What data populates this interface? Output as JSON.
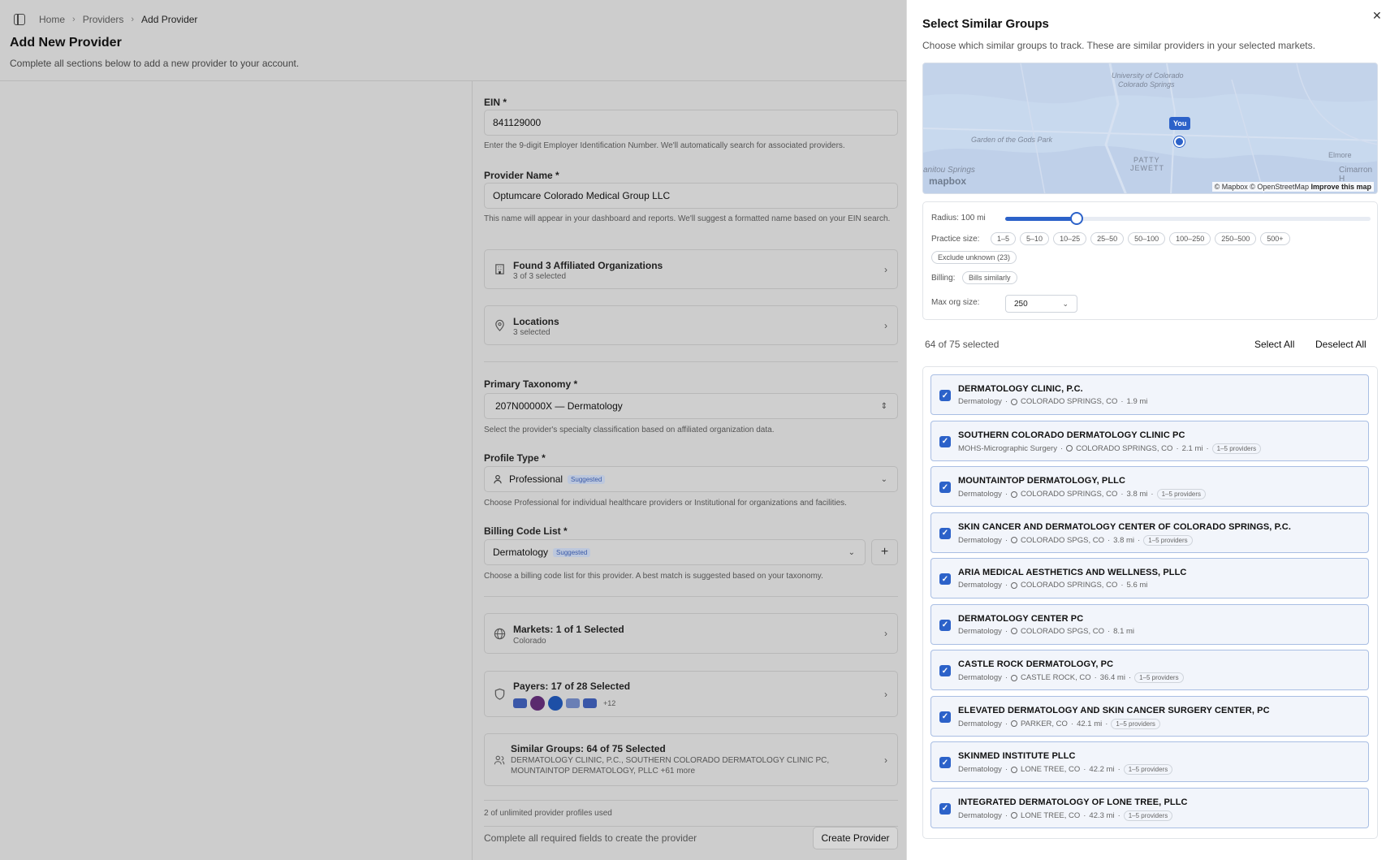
{
  "breadcrumb": {
    "items": [
      "Home",
      "Providers",
      "Add Provider"
    ]
  },
  "page": {
    "title": "Add New Provider",
    "subtitle": "Complete all sections below to add a new provider to your account."
  },
  "form": {
    "ein": {
      "label": "EIN *",
      "value": "841129000",
      "help": "Enter the 9-digit Employer Identification Number. We'll automatically search for associated providers."
    },
    "provider_name": {
      "label": "Provider Name *",
      "value": "Optumcare Colorado Medical Group LLC",
      "help": "This name will appear in your dashboard and reports. We'll suggest a formatted name based on your EIN search."
    },
    "affiliated": {
      "title": "Found 3 Affiliated Organizations",
      "sub": "3 of 3 selected"
    },
    "locations": {
      "title": "Locations",
      "sub": "3 selected"
    },
    "taxonomy": {
      "label": "Primary Taxonomy *",
      "value": "207N00000X — Dermatology",
      "help": "Select the provider's specialty classification based on affiliated organization data."
    },
    "profile_type": {
      "label": "Profile Type *",
      "value": "Professional",
      "badge": "Suggested",
      "help": "Choose Professional for individual healthcare providers or Institutional for organizations and facilities."
    },
    "billing": {
      "label": "Billing Code List *",
      "value": "Dermatology",
      "badge": "Suggested",
      "help": "Choose a billing code list for this provider. A best match is suggested based on your taxonomy."
    },
    "markets": {
      "title": "Markets: 1 of 1 Selected",
      "sub": "Colorado"
    },
    "payers": {
      "title": "Payers: 17 of 28 Selected",
      "more": "+12"
    },
    "similar": {
      "title": "Similar Groups: 64 of 75 Selected",
      "sub": "DERMATOLOGY CLINIC, P.C., SOUTHERN COLORADO DERMATOLOGY CLINIC PC, MOUNTAINTOP DERMATOLOGY, PLLC +61 more"
    },
    "usage": "2 of unlimited provider profiles used",
    "footer_msg": "Complete all required fields to create the provider",
    "create_label": "Create Provider"
  },
  "panel": {
    "title": "Select Similar Groups",
    "subtitle": "Choose which similar groups to track. These are similar providers in your selected markets.",
    "map": {
      "labels": [
        "University of Colorado",
        "Colorado Springs",
        "Garden of the Gods Park",
        "anitou Springs",
        "PATTY",
        "JEWETT",
        "Elmore",
        "Cimarron H"
      ],
      "you": "You",
      "logo": "mapbox",
      "credit": "© Mapbox © OpenStreetMap",
      "improve": "Improve this map"
    },
    "filters": {
      "radius_label": "Radius: 100 mi",
      "radius_fraction": 0.195,
      "practice_label": "Practice size:",
      "practice_sizes": [
        "1–5",
        "5–10",
        "10–25",
        "25–50",
        "50–100",
        "100–250",
        "250–500",
        "500+"
      ],
      "exclude_unknown": "Exclude unknown (23)",
      "billing_label": "Billing:",
      "billing_chip": "Bills similarly",
      "max_label": "Max org size:",
      "max_value": "250"
    },
    "selected_count": "64 of 75 selected",
    "select_all": "Select All",
    "deselect_all": "Deselect All",
    "groups": [
      {
        "name": "DERMATOLOGY CLINIC, P.C.",
        "specialty": "Dermatology",
        "location": "COLORADO SPRINGS, CO",
        "distance": "1.9 mi",
        "providers": ""
      },
      {
        "name": "SOUTHERN COLORADO DERMATOLOGY CLINIC PC",
        "specialty": "MOHS-Micrographic Surgery",
        "location": "COLORADO SPRINGS, CO",
        "distance": "2.1 mi",
        "providers": "1–5 providers"
      },
      {
        "name": "MOUNTAINTOP DERMATOLOGY, PLLC",
        "specialty": "Dermatology",
        "location": "COLORADO SPRINGS, CO",
        "distance": "3.8 mi",
        "providers": "1–5 providers"
      },
      {
        "name": "SKIN CANCER AND DERMATOLOGY CENTER OF COLORADO SPRINGS, P.C.",
        "specialty": "Dermatology",
        "location": "COLORADO SPGS, CO",
        "distance": "3.8 mi",
        "providers": "1–5 providers"
      },
      {
        "name": "ARIA MEDICAL AESTHETICS AND WELLNESS, PLLC",
        "specialty": "Dermatology",
        "location": "COLORADO SPRINGS, CO",
        "distance": "5.6 mi",
        "providers": ""
      },
      {
        "name": "DERMATOLOGY CENTER PC",
        "specialty": "Dermatology",
        "location": "COLORADO SPGS, CO",
        "distance": "8.1 mi",
        "providers": ""
      },
      {
        "name": "CASTLE ROCK DERMATOLOGY, PC",
        "specialty": "Dermatology",
        "location": "CASTLE ROCK, CO",
        "distance": "36.4 mi",
        "providers": "1–5 providers"
      },
      {
        "name": "ELEVATED DERMATOLOGY AND SKIN CANCER SURGERY CENTER, PC",
        "specialty": "Dermatology",
        "location": "PARKER, CO",
        "distance": "42.1 mi",
        "providers": "1–5 providers"
      },
      {
        "name": "SKINMED INSTITUTE PLLC",
        "specialty": "Dermatology",
        "location": "LONE TREE, CO",
        "distance": "42.2 mi",
        "providers": "1–5 providers"
      },
      {
        "name": "INTEGRATED DERMATOLOGY OF LONE TREE, PLLC",
        "specialty": "Dermatology",
        "location": "LONE TREE, CO",
        "distance": "42.3 mi",
        "providers": "1–5 providers"
      }
    ]
  }
}
